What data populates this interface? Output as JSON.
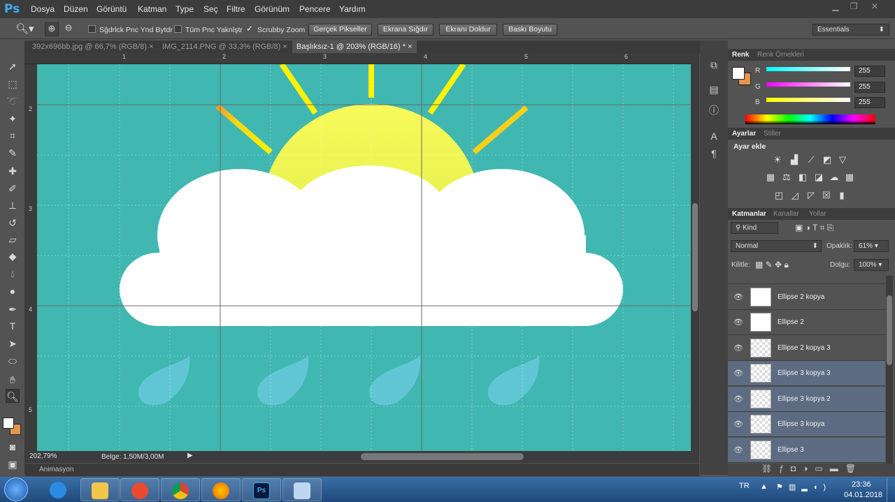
{
  "app": {
    "logo": "Ps"
  },
  "menu": [
    "Dosya",
    "Düzen",
    "Görüntü",
    "Katman",
    "Type",
    "Seç",
    "Filtre",
    "Görünüm",
    "Pencere",
    "Yardım"
  ],
  "options": {
    "resize_windows": "Sğdrlck Pnc Ynd Bytdr",
    "all_windows": "Tüm Pnc Yaknlştr",
    "scrubby_zoom": "Scrubby Zoom",
    "btn_actual": "Gerçek Pikseller",
    "btn_fit": "Ekrana Sığdır",
    "btn_fill": "Ekranı Doldur",
    "btn_print": "Baskı Boyutu",
    "workspace": "Essentials"
  },
  "tabs": [
    {
      "label": "392x696bb.jpg @ 66,7% (RGB/8)"
    },
    {
      "label": "IMG_2114.PNG @ 33,3% (RGB/8)"
    },
    {
      "label": "Başlıksız-1 @ 203% (RGB/16) *"
    }
  ],
  "ruler": {
    "top": [
      "1",
      "2",
      "3",
      "4",
      "5",
      "6"
    ],
    "left": [
      "2",
      "3",
      "4",
      "5"
    ]
  },
  "status": {
    "zoom": "202,79%",
    "doc": "Belge: 1,50M/3,00M"
  },
  "animation_tab": "Animasyon",
  "color_panel": {
    "tabs": [
      "Renk",
      "Renk Örnekleri"
    ],
    "r_label": "R",
    "g_label": "G",
    "b_label": "B",
    "r": "255",
    "g": "255",
    "b": "255"
  },
  "adjustments": {
    "tabs": [
      "Ayarlar",
      "Stiller"
    ],
    "title": "Ayar ekle"
  },
  "layers_panel": {
    "tabs": [
      "Katmanlar",
      "Kanallar",
      "Yollar"
    ],
    "filter": "Kind",
    "blend": "Normal",
    "opacity_label": "Opaklık:",
    "opacity": "61%",
    "lock_label": "Kilitle:",
    "fill_label": "Dolgu:",
    "fill": "100%",
    "layers": [
      {
        "name": "Ellipse 2 kopya"
      },
      {
        "name": "Ellipse 2"
      },
      {
        "name": "Ellipse 2 kopya 3"
      },
      {
        "name": "Ellipse 3 kopya 3"
      },
      {
        "name": "Ellipse 3 kopya 2"
      },
      {
        "name": "Ellipse 3 kopya"
      },
      {
        "name": "Ellipse 3"
      }
    ]
  },
  "taskbar": {
    "lang": "TR",
    "time": "23:36",
    "date": "04.01.2018"
  },
  "colors": {
    "canvas": "#40b7b0",
    "sun": "#f4f45a",
    "cloud": "#ffffff",
    "drop": "#6ccbe0",
    "foreground": "#ffffff",
    "background": "#e2954f"
  }
}
